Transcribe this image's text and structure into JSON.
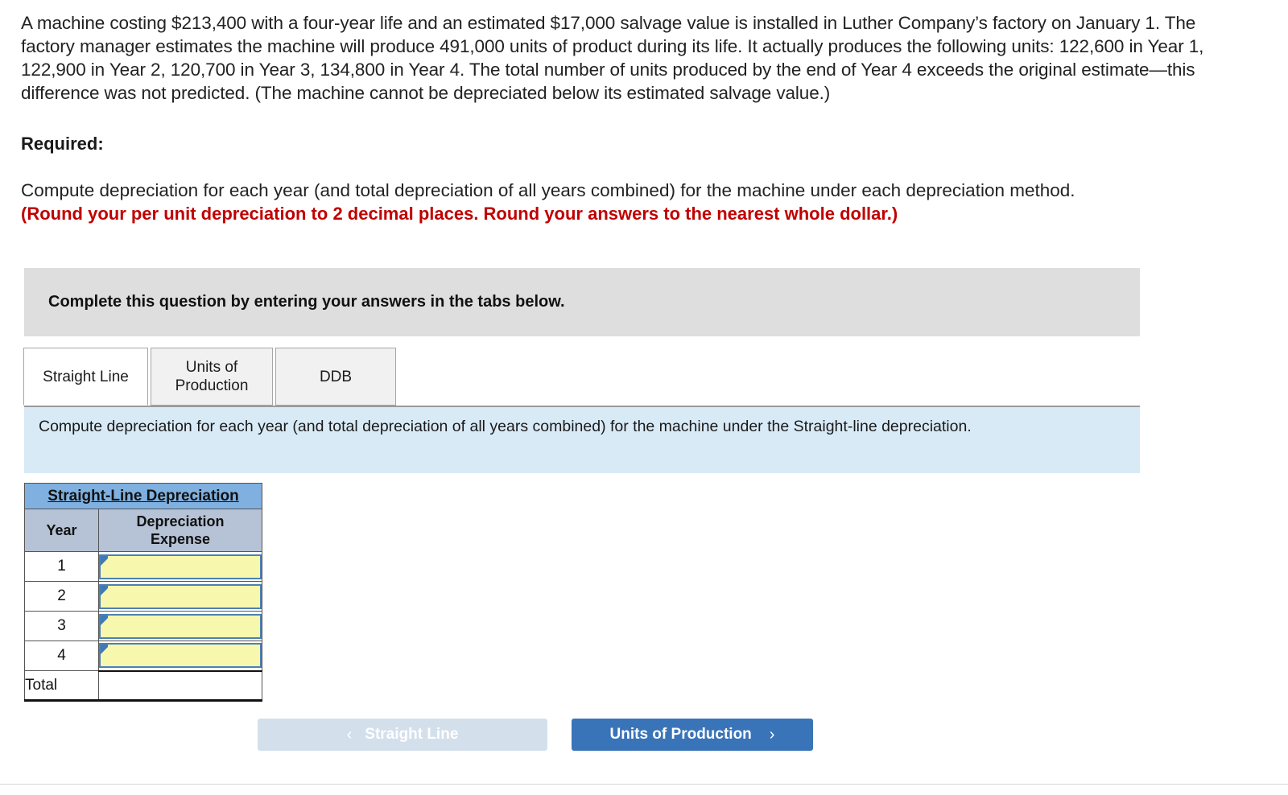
{
  "question": {
    "body": "A machine costing $213,400 with a four-year life and an estimated $17,000 salvage value is installed in Luther Company’s factory on January 1. The factory manager estimates the machine will produce 491,000 units of product during its life. It actually produces the following units: 122,600 in Year 1, 122,900 in Year 2, 120,700 in Year 3, 134,800 in Year 4. The total number of units produced by the end of Year 4 exceeds the original estimate—this difference was not predicted. (The machine cannot be depreciated below its estimated salvage value.)",
    "required_label": "Required:",
    "compute_line": "Compute depreciation for each year (and total depreciation of all years combined) for the machine under each depreciation method.",
    "round_note": "(Round your per unit depreciation to 2 decimal places. Round your answers to the nearest whole dollar.)"
  },
  "banner": {
    "text": "Complete this question by entering your answers in the tabs below."
  },
  "tabs": [
    {
      "label": "Straight Line",
      "active": true
    },
    {
      "label": "Units of Production",
      "active": false
    },
    {
      "label": "DDB",
      "active": false
    }
  ],
  "tab_labels": {
    "straight_line": "Straight Line",
    "units_of_production_line1": "Units of",
    "units_of_production_line2": "Production",
    "ddb": "DDB"
  },
  "sub_instruction": {
    "text": "Compute depreciation for each year (and total depreciation of all years combined) for the machine under the Straight-line depreciation."
  },
  "table": {
    "title": "Straight-Line Depreciation",
    "headers": {
      "year": "Year",
      "expense_line1": "Depreciation",
      "expense_line2": "Expense"
    },
    "rows": [
      {
        "year": "1",
        "expense": ""
      },
      {
        "year": "2",
        "expense": ""
      },
      {
        "year": "3",
        "expense": ""
      },
      {
        "year": "4",
        "expense": ""
      }
    ],
    "total_label": "Total",
    "total_value": ""
  },
  "nav": {
    "prev_label": "Straight Line",
    "prev_chevron": "‹",
    "next_label": "Units of Production",
    "next_chevron": "›"
  },
  "colors": {
    "banner_gray": "#dedede",
    "panel_blue": "#d9eaf7",
    "table_title_blue": "#7fb0e0",
    "table_header_gray": "#b6c2d6",
    "input_yellow": "#f7f7ad",
    "input_border_blue": "#4a81b5",
    "primary_button": "#3a74b8",
    "disabled_button": "#d4dfec",
    "red_note": "#c00000"
  }
}
